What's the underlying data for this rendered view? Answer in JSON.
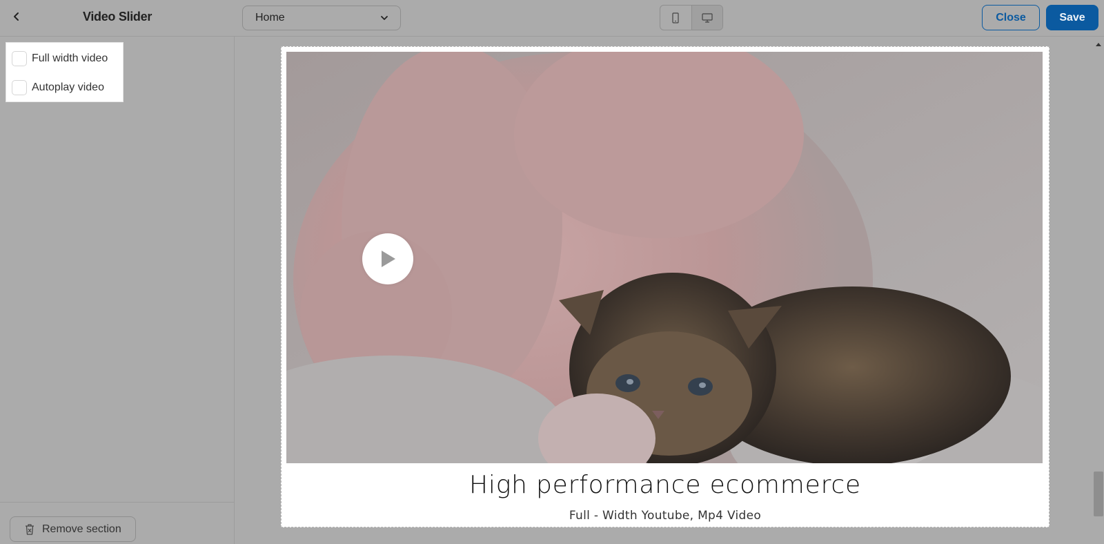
{
  "header": {
    "panel_title": "Video Slider",
    "page_select": {
      "value": "Home"
    },
    "close_label": "Close",
    "save_label": "Save"
  },
  "icons": {
    "back": "chevron-left-icon",
    "dropdown": "chevron-down-icon",
    "mobile": "mobile-icon",
    "desktop": "desktop-icon",
    "delete": "trash-icon",
    "play": "play-icon"
  },
  "colors": {
    "accent": "#0b5aa0",
    "overlay": "#ababab"
  },
  "sidebar": {
    "options": [
      {
        "label": "Full width video",
        "checked": false
      },
      {
        "label": "Autoplay video",
        "checked": false
      }
    ],
    "remove_label": "Remove section"
  },
  "slide": {
    "title": "High performance ecommerce",
    "subtitle": "Full - Width Youtube, Mp4 Video"
  }
}
